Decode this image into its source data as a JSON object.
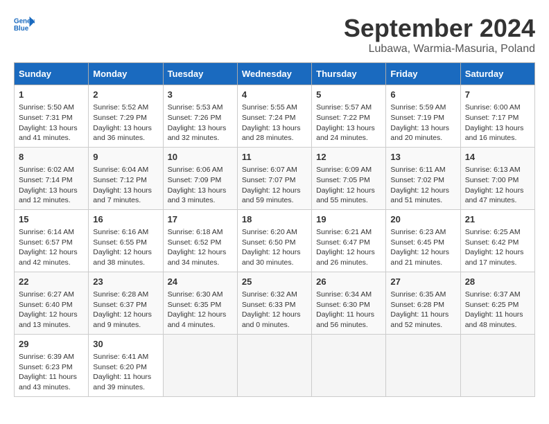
{
  "logo": {
    "line1": "General",
    "line2": "Blue"
  },
  "title": "September 2024",
  "location": "Lubawa, Warmia-Masuria, Poland",
  "weekdays": [
    "Sunday",
    "Monday",
    "Tuesday",
    "Wednesday",
    "Thursday",
    "Friday",
    "Saturday"
  ],
  "weeks": [
    [
      {
        "day": "1",
        "sunrise": "Sunrise: 5:50 AM",
        "sunset": "Sunset: 7:31 PM",
        "daylight": "Daylight: 13 hours and 41 minutes."
      },
      {
        "day": "2",
        "sunrise": "Sunrise: 5:52 AM",
        "sunset": "Sunset: 7:29 PM",
        "daylight": "Daylight: 13 hours and 36 minutes."
      },
      {
        "day": "3",
        "sunrise": "Sunrise: 5:53 AM",
        "sunset": "Sunset: 7:26 PM",
        "daylight": "Daylight: 13 hours and 32 minutes."
      },
      {
        "day": "4",
        "sunrise": "Sunrise: 5:55 AM",
        "sunset": "Sunset: 7:24 PM",
        "daylight": "Daylight: 13 hours and 28 minutes."
      },
      {
        "day": "5",
        "sunrise": "Sunrise: 5:57 AM",
        "sunset": "Sunset: 7:22 PM",
        "daylight": "Daylight: 13 hours and 24 minutes."
      },
      {
        "day": "6",
        "sunrise": "Sunrise: 5:59 AM",
        "sunset": "Sunset: 7:19 PM",
        "daylight": "Daylight: 13 hours and 20 minutes."
      },
      {
        "day": "7",
        "sunrise": "Sunrise: 6:00 AM",
        "sunset": "Sunset: 7:17 PM",
        "daylight": "Daylight: 13 hours and 16 minutes."
      }
    ],
    [
      {
        "day": "8",
        "sunrise": "Sunrise: 6:02 AM",
        "sunset": "Sunset: 7:14 PM",
        "daylight": "Daylight: 13 hours and 12 minutes."
      },
      {
        "day": "9",
        "sunrise": "Sunrise: 6:04 AM",
        "sunset": "Sunset: 7:12 PM",
        "daylight": "Daylight: 13 hours and 7 minutes."
      },
      {
        "day": "10",
        "sunrise": "Sunrise: 6:06 AM",
        "sunset": "Sunset: 7:09 PM",
        "daylight": "Daylight: 13 hours and 3 minutes."
      },
      {
        "day": "11",
        "sunrise": "Sunrise: 6:07 AM",
        "sunset": "Sunset: 7:07 PM",
        "daylight": "Daylight: 12 hours and 59 minutes."
      },
      {
        "day": "12",
        "sunrise": "Sunrise: 6:09 AM",
        "sunset": "Sunset: 7:05 PM",
        "daylight": "Daylight: 12 hours and 55 minutes."
      },
      {
        "day": "13",
        "sunrise": "Sunrise: 6:11 AM",
        "sunset": "Sunset: 7:02 PM",
        "daylight": "Daylight: 12 hours and 51 minutes."
      },
      {
        "day": "14",
        "sunrise": "Sunrise: 6:13 AM",
        "sunset": "Sunset: 7:00 PM",
        "daylight": "Daylight: 12 hours and 47 minutes."
      }
    ],
    [
      {
        "day": "15",
        "sunrise": "Sunrise: 6:14 AM",
        "sunset": "Sunset: 6:57 PM",
        "daylight": "Daylight: 12 hours and 42 minutes."
      },
      {
        "day": "16",
        "sunrise": "Sunrise: 6:16 AM",
        "sunset": "Sunset: 6:55 PM",
        "daylight": "Daylight: 12 hours and 38 minutes."
      },
      {
        "day": "17",
        "sunrise": "Sunrise: 6:18 AM",
        "sunset": "Sunset: 6:52 PM",
        "daylight": "Daylight: 12 hours and 34 minutes."
      },
      {
        "day": "18",
        "sunrise": "Sunrise: 6:20 AM",
        "sunset": "Sunset: 6:50 PM",
        "daylight": "Daylight: 12 hours and 30 minutes."
      },
      {
        "day": "19",
        "sunrise": "Sunrise: 6:21 AM",
        "sunset": "Sunset: 6:47 PM",
        "daylight": "Daylight: 12 hours and 26 minutes."
      },
      {
        "day": "20",
        "sunrise": "Sunrise: 6:23 AM",
        "sunset": "Sunset: 6:45 PM",
        "daylight": "Daylight: 12 hours and 21 minutes."
      },
      {
        "day": "21",
        "sunrise": "Sunrise: 6:25 AM",
        "sunset": "Sunset: 6:42 PM",
        "daylight": "Daylight: 12 hours and 17 minutes."
      }
    ],
    [
      {
        "day": "22",
        "sunrise": "Sunrise: 6:27 AM",
        "sunset": "Sunset: 6:40 PM",
        "daylight": "Daylight: 12 hours and 13 minutes."
      },
      {
        "day": "23",
        "sunrise": "Sunrise: 6:28 AM",
        "sunset": "Sunset: 6:37 PM",
        "daylight": "Daylight: 12 hours and 9 minutes."
      },
      {
        "day": "24",
        "sunrise": "Sunrise: 6:30 AM",
        "sunset": "Sunset: 6:35 PM",
        "daylight": "Daylight: 12 hours and 4 minutes."
      },
      {
        "day": "25",
        "sunrise": "Sunrise: 6:32 AM",
        "sunset": "Sunset: 6:33 PM",
        "daylight": "Daylight: 12 hours and 0 minutes."
      },
      {
        "day": "26",
        "sunrise": "Sunrise: 6:34 AM",
        "sunset": "Sunset: 6:30 PM",
        "daylight": "Daylight: 11 hours and 56 minutes."
      },
      {
        "day": "27",
        "sunrise": "Sunrise: 6:35 AM",
        "sunset": "Sunset: 6:28 PM",
        "daylight": "Daylight: 11 hours and 52 minutes."
      },
      {
        "day": "28",
        "sunrise": "Sunrise: 6:37 AM",
        "sunset": "Sunset: 6:25 PM",
        "daylight": "Daylight: 11 hours and 48 minutes."
      }
    ],
    [
      {
        "day": "29",
        "sunrise": "Sunrise: 6:39 AM",
        "sunset": "Sunset: 6:23 PM",
        "daylight": "Daylight: 11 hours and 43 minutes."
      },
      {
        "day": "30",
        "sunrise": "Sunrise: 6:41 AM",
        "sunset": "Sunset: 6:20 PM",
        "daylight": "Daylight: 11 hours and 39 minutes."
      },
      null,
      null,
      null,
      null,
      null
    ]
  ]
}
